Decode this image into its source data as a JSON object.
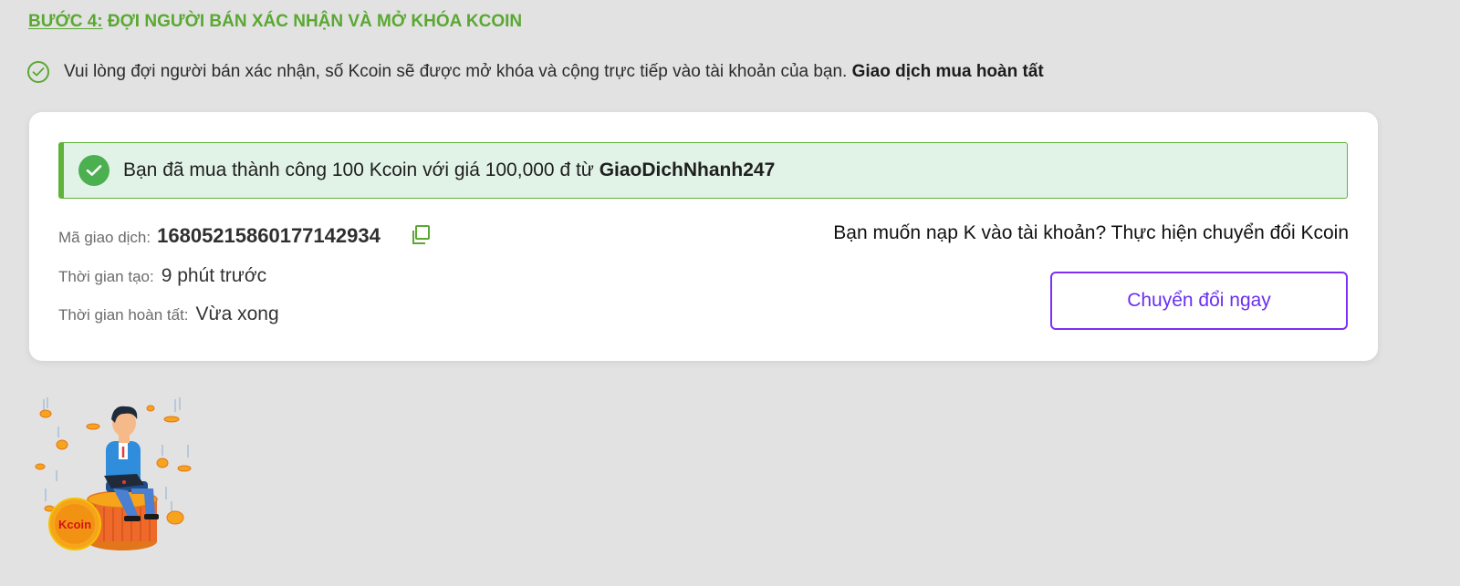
{
  "step": {
    "number_label": "BƯỚC 4:",
    "title": "ĐỢI NGƯỜI BÁN XÁC NHẬN VÀ MỞ KHÓA KCOIN"
  },
  "instruction": {
    "text": "Vui lòng đợi người bán xác nhận, số Kcoin sẽ được mở khóa và cộng trực tiếp vào tài khoản của bạn.",
    "bold_text": "Giao dịch mua hoàn tất"
  },
  "alert": {
    "message": "Bạn đã mua thành công 100 Kcoin với giá 100,000 đ từ",
    "seller": "GiaoDichNhanh247"
  },
  "transaction": {
    "id_label": "Mã giao dịch:",
    "id_value": "16805215860177142934",
    "created_label": "Thời gian tạo:",
    "created_value": "9 phút trước",
    "completed_label": "Thời gian hoàn tất:",
    "completed_value": "Vừa xong"
  },
  "convert": {
    "question": "Bạn muốn nạp K vào tài khoản? Thực hiện chuyển đổi Kcoin",
    "button_label": "Chuyển đổi ngay"
  },
  "illustration": {
    "coin_text": "Kcoin"
  },
  "colors": {
    "accent_green": "#5aa832",
    "alert_bg": "#e1f3e6",
    "button_purple": "#7b2ff7",
    "page_bg": "#e2e2e2"
  },
  "icons": {
    "instruction": "check-circle-outline-icon",
    "alert": "check-circle-filled-icon",
    "copy": "copy-icon"
  }
}
